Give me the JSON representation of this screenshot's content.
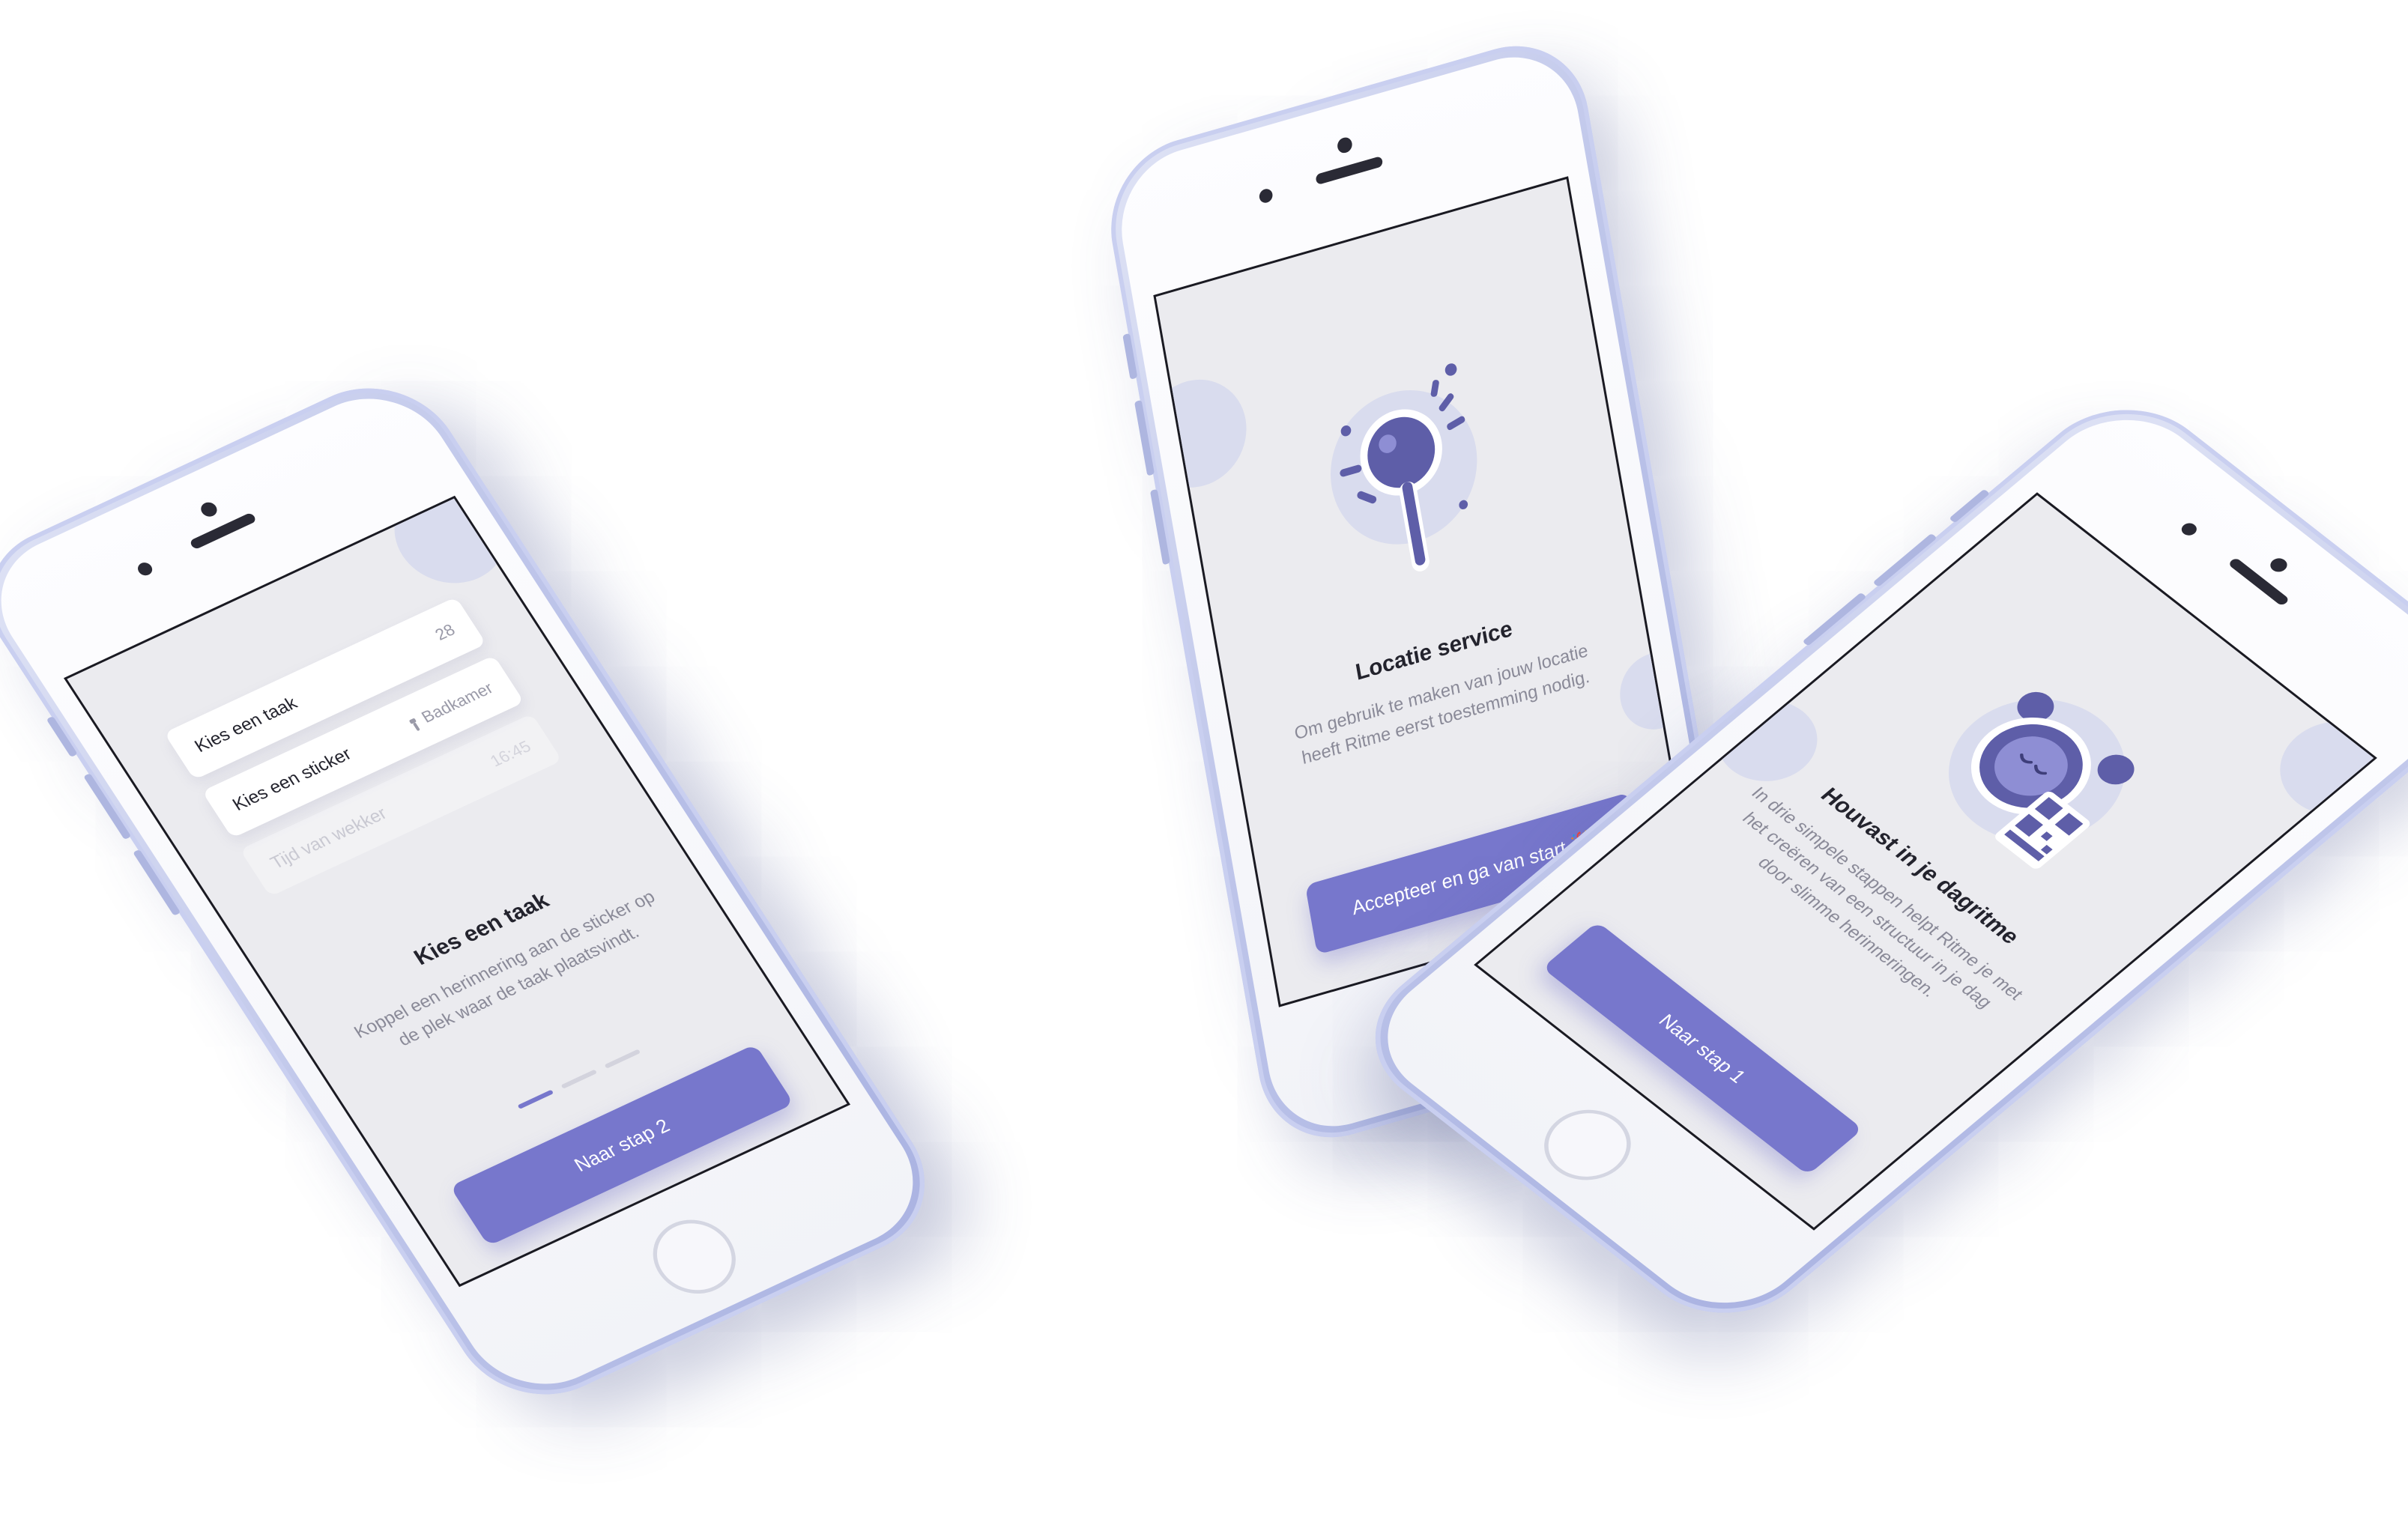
{
  "colors": {
    "accent": "#7777cc",
    "screen_bg": "#ebebef",
    "card_bg": "#ffffff",
    "deco_circle": "#d9dcee",
    "text_dark": "#23232d",
    "text_muted": "#8a8a98"
  },
  "phone_task": {
    "cards": [
      {
        "label": "Kies een taak",
        "meta": "28"
      },
      {
        "label": "Kies een sticker",
        "meta": "Badkamer",
        "meta_icon": "sticker-icon"
      },
      {
        "label": "Tijd van wekker",
        "meta": "16:45"
      }
    ],
    "title": "Kies een taak",
    "body": "Koppel een herinnering aan de sticker op de plek waar de taak plaatsvindt.",
    "progress": {
      "current": 1,
      "total": 3
    },
    "cta_label": "Naar stap 2"
  },
  "phone_location": {
    "illustration": "location-pin-icon",
    "title": "Locatie service",
    "body": "Om gebruik te maken van jouw locatie heeft Ritme eerst toestemming nodig.",
    "cta_label": "Accepteer en ga van start 🎉"
  },
  "phone_intro": {
    "illustration": "alarm-clock-qr-icon",
    "title": "Houvast in je dagritme",
    "body": "In drie simpele stappen helpt Ritme je met het creëren van een structuur in je dag door slimme herinneringen.",
    "cta_label": "Naar stap 1"
  }
}
